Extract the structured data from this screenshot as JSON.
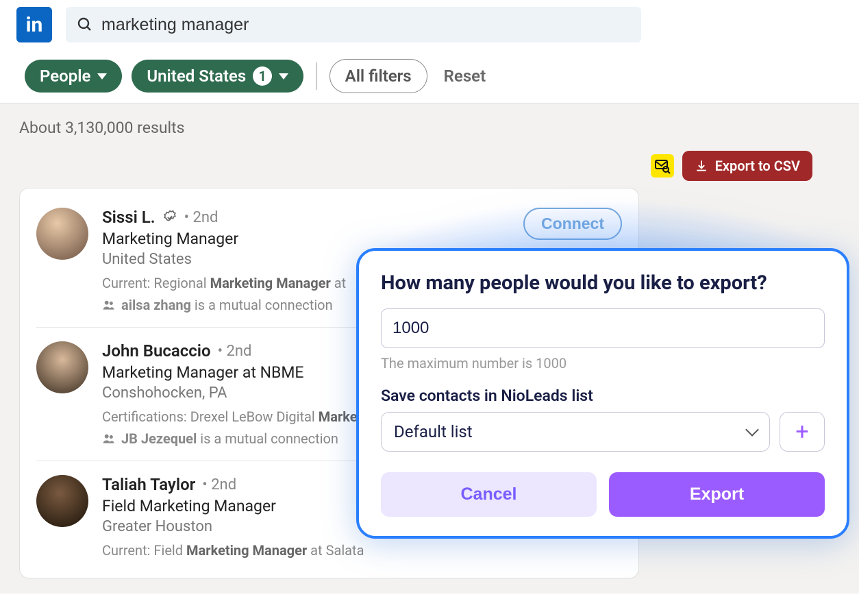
{
  "topbar": {
    "logo_text": "in",
    "search_value": "marketing manager"
  },
  "filters": {
    "people": "People",
    "location": "United States",
    "location_badge": "1",
    "all_filters": "All filters",
    "reset": "Reset"
  },
  "results": {
    "count_text": "About 3,130,000 results",
    "export_label": "Export to CSV"
  },
  "people": [
    {
      "name": "Sissi L.",
      "degree": "2nd",
      "verified": true,
      "title": "Marketing Manager",
      "location": "United States",
      "current_prefix": "Current: Regional ",
      "current_bold": "Marketing Manager",
      "current_suffix": " at ",
      "mutual_name": "ailsa zhang",
      "mutual_suffix": " is a mutual connection",
      "connect": "Connect",
      "meta_label": "Current:"
    },
    {
      "name": "John Bucaccio",
      "degree": "2nd",
      "verified": false,
      "title": "Marketing Manager at NBME",
      "location": "Conshohocken, PA",
      "current_prefix": "Certifications: Drexel LeBow Digital ",
      "current_bold": "Marke",
      "current_suffix": "",
      "mutual_name": "JB Jezequel",
      "mutual_suffix": " is a mutual connection",
      "meta_label": "Certifications:"
    },
    {
      "name": "Taliah Taylor",
      "degree": "2nd",
      "verified": false,
      "title": "Field Marketing Manager",
      "location": "Greater Houston",
      "current_prefix": "Current: Field ",
      "current_bold": "Marketing Manager",
      "current_suffix": " at Salata",
      "meta_label": "Current:"
    }
  ],
  "dialog": {
    "title": "How many people would you like to export?",
    "count_value": "1000",
    "hint": "The maximum number is 1000",
    "save_label": "Save contacts in NioLeads list",
    "selected_list": "Default list",
    "cancel": "Cancel",
    "export": "Export"
  }
}
